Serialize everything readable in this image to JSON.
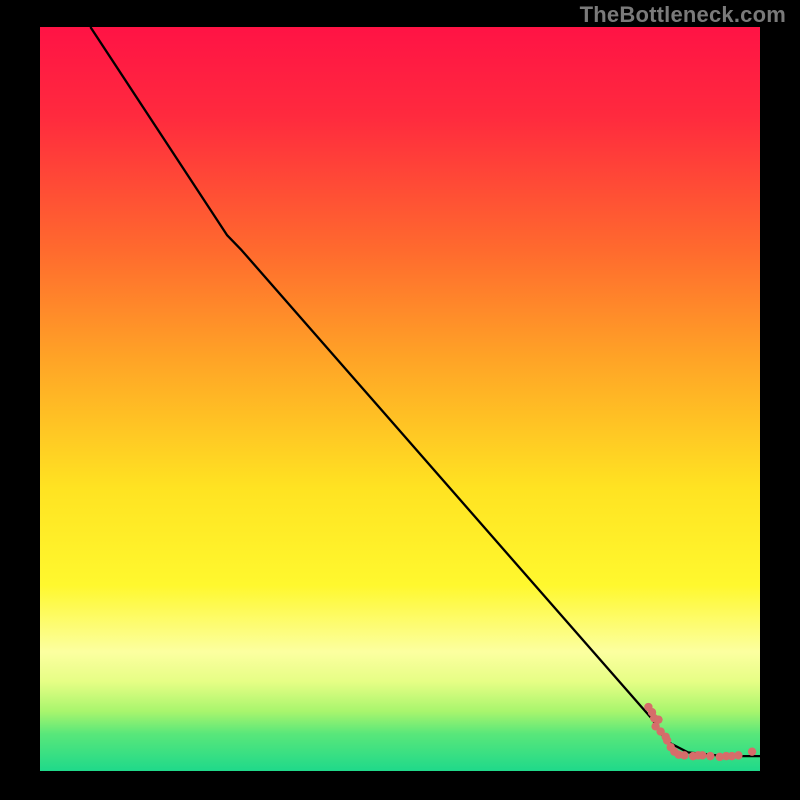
{
  "watermark": "TheBottleneck.com",
  "chart_data": {
    "type": "line",
    "title": "",
    "xlabel": "",
    "ylabel": "",
    "xlim": [
      0,
      100
    ],
    "ylim": [
      0,
      100
    ],
    "background_gradient_stops": [
      {
        "offset": 0,
        "color": "#ff1345"
      },
      {
        "offset": 12,
        "color": "#ff2a3e"
      },
      {
        "offset": 30,
        "color": "#ff6a2e"
      },
      {
        "offset": 45,
        "color": "#ffa526"
      },
      {
        "offset": 62,
        "color": "#ffe322"
      },
      {
        "offset": 75,
        "color": "#fff82e"
      },
      {
        "offset": 84,
        "color": "#fcffa0"
      },
      {
        "offset": 88,
        "color": "#e6fe85"
      },
      {
        "offset": 92,
        "color": "#a8f56d"
      },
      {
        "offset": 95,
        "color": "#59e77a"
      },
      {
        "offset": 100,
        "color": "#1fd98a"
      }
    ],
    "curve": [
      {
        "x": 7,
        "y": 100
      },
      {
        "x": 26,
        "y": 72
      },
      {
        "x": 28,
        "y": 70
      },
      {
        "x": 85,
        "y": 7
      },
      {
        "x": 87,
        "y": 4
      },
      {
        "x": 90,
        "y": 2.5
      },
      {
        "x": 95,
        "y": 2
      },
      {
        "x": 100,
        "y": 2
      }
    ],
    "scatter": [
      {
        "x": 84.5,
        "y": 8.6
      },
      {
        "x": 85.0,
        "y": 7.9
      },
      {
        "x": 85.3,
        "y": 7.1
      },
      {
        "x": 85.9,
        "y": 6.9
      },
      {
        "x": 85.5,
        "y": 6.0
      },
      {
        "x": 86.2,
        "y": 5.3
      },
      {
        "x": 86.9,
        "y": 4.6
      },
      {
        "x": 87.1,
        "y": 4.1
      },
      {
        "x": 87.6,
        "y": 3.2
      },
      {
        "x": 88.1,
        "y": 2.6
      },
      {
        "x": 88.7,
        "y": 2.2
      },
      {
        "x": 89.5,
        "y": 2.1
      },
      {
        "x": 90.7,
        "y": 2.0
      },
      {
        "x": 91.4,
        "y": 2.1
      },
      {
        "x": 92.0,
        "y": 2.1
      },
      {
        "x": 93.1,
        "y": 2.0
      },
      {
        "x": 94.4,
        "y": 1.9
      },
      {
        "x": 95.3,
        "y": 2.0
      },
      {
        "x": 96.1,
        "y": 2.0
      },
      {
        "x": 97.0,
        "y": 2.1
      },
      {
        "x": 98.9,
        "y": 2.6
      }
    ]
  }
}
